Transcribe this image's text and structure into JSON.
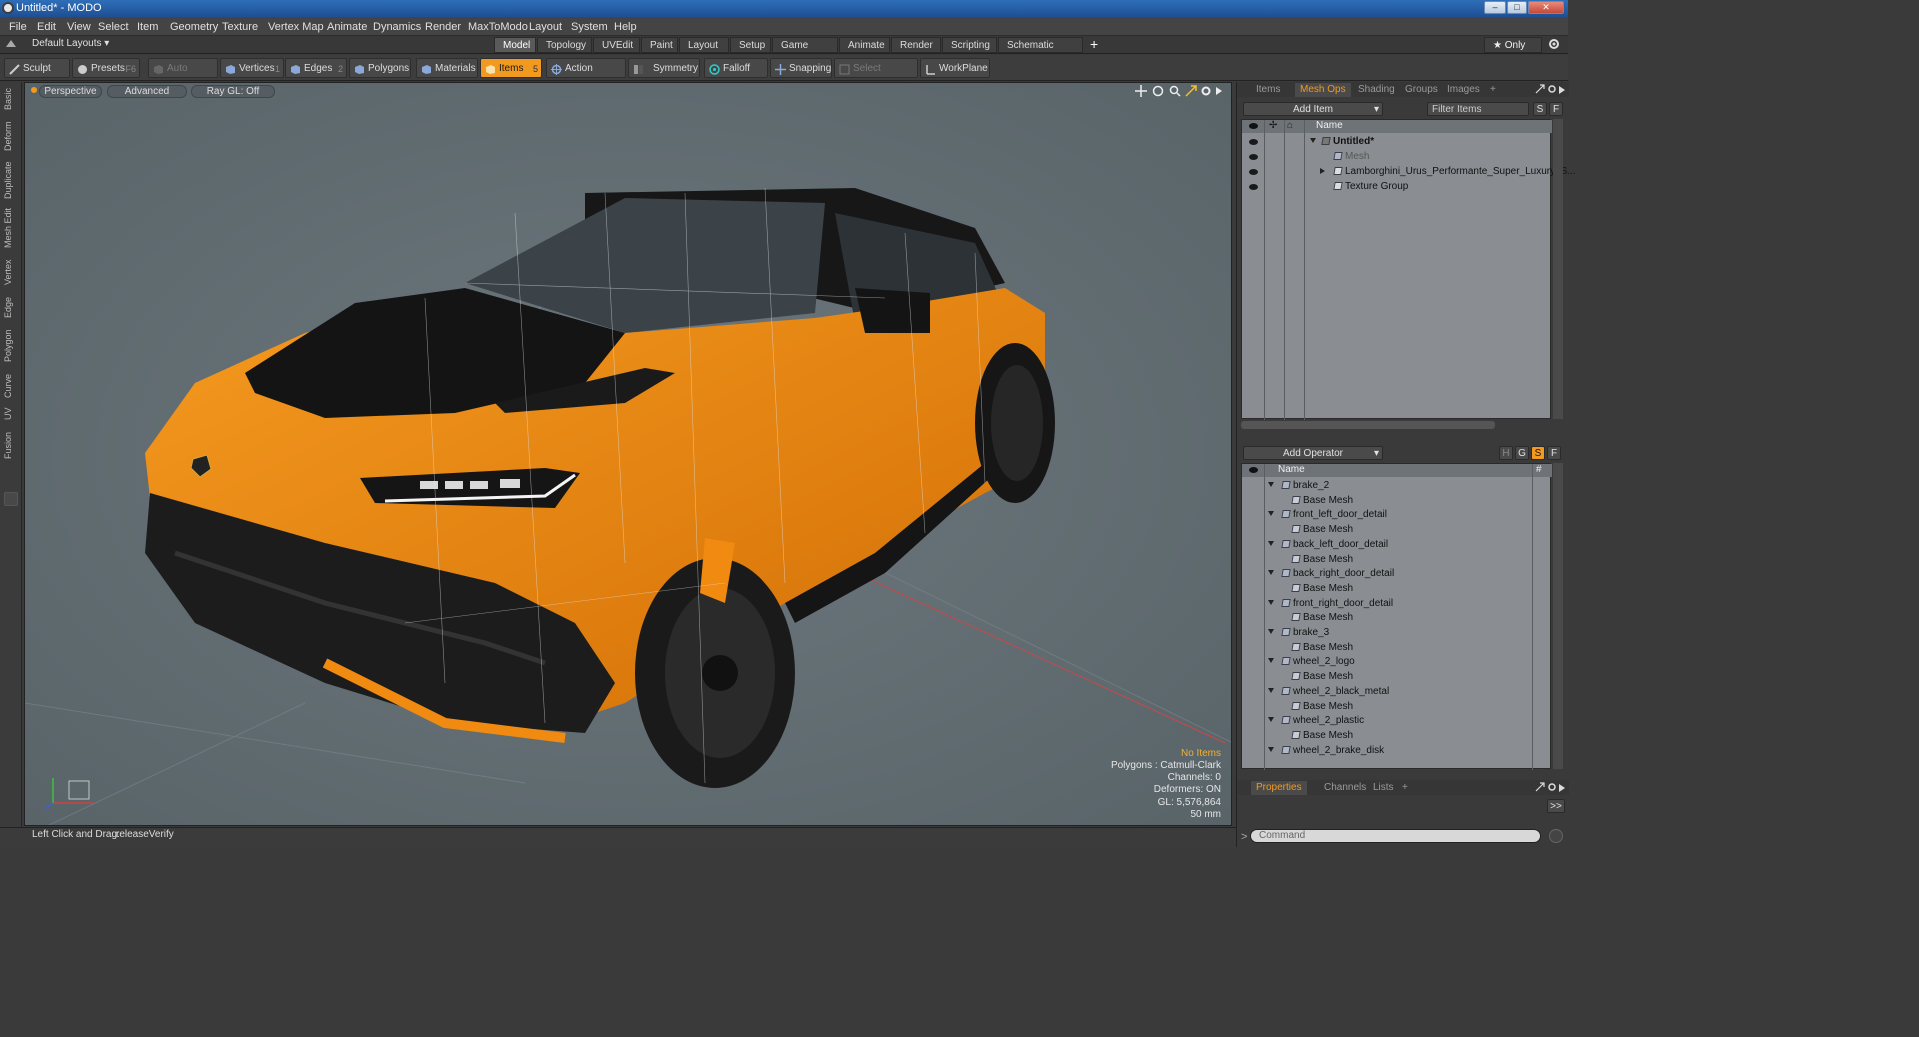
{
  "window": {
    "title": "Untitled* - MODO",
    "min": "–",
    "max": "□",
    "close": "✕"
  },
  "menubar": [
    "File",
    "Edit",
    "View",
    "Select",
    "Item",
    "Geometry",
    "Texture",
    "Vertex Map",
    "Animate",
    "Dynamics",
    "Render",
    "MaxToModo",
    "Layout",
    "System",
    "Help"
  ],
  "layoutbar": {
    "layouts_label": "Default Layouts ▾",
    "tabs": [
      "Model",
      "Topology",
      "UVEdit",
      "Paint",
      "Layout",
      "Setup",
      "Game Tools",
      "Animate",
      "Render",
      "Scripting",
      "Schematic Fusion"
    ],
    "active_tab": "Model",
    "add": "+",
    "only": "★  Only"
  },
  "toolbar": {
    "sculpt": "Sculpt",
    "presets": "Presets",
    "presets_key": "F6",
    "auto_select": "Auto Select",
    "vertices": "Vertices",
    "vertices_key": "1",
    "edges": "Edges",
    "edges_key": "2",
    "polygons": "Polygons",
    "materials": "Materials",
    "items": "Items",
    "items_key": "5",
    "action_center": "Action Center",
    "symmetry": "Symmetry",
    "falloff": "Falloff",
    "snapping": "Snapping",
    "select_through": "Select Through",
    "workplane": "WorkPlane"
  },
  "left_tabs": [
    "Basic",
    "Deform",
    "Duplicate",
    "Mesh Edit",
    "Vertex",
    "Edge",
    "Polygon",
    "Curve",
    "UV",
    "Fusion"
  ],
  "viewport": {
    "view_mode": "Perspective",
    "shading": "Advanced",
    "raygl": "Ray GL: Off",
    "info": {
      "items": "No Items",
      "polygons": "Polygons : Catmull-Clark",
      "channels": "Channels: 0",
      "deformers": "Deformers: ON",
      "gl": "GL: 5,576,864",
      "scale": "50 mm"
    }
  },
  "statusbar": {
    "hint_label": "Left Click and Drag:",
    "hint_value": "releaseVerify"
  },
  "items_panel": {
    "tabs": [
      "Items",
      "Mesh Ops",
      "Shading",
      "Groups",
      "Images"
    ],
    "active_tab": "Mesh Ops",
    "add_item": "Add Item",
    "filter": "Filter Items",
    "s_btn": "S",
    "f_btn": "F",
    "col_name": "Name",
    "tree": [
      {
        "label": "Untitled*",
        "level": 0
      },
      {
        "label": "Mesh",
        "level": 1
      },
      {
        "label": "Lamborghini_Urus_Performante_Super_Luxury_S...",
        "level": 1
      },
      {
        "label": "Texture Group",
        "level": 1
      }
    ]
  },
  "meshops_panel": {
    "add_operator": "Add Operator",
    "col_name": "Name",
    "col_hash": "#",
    "btn_h": "H",
    "btn_g": "G",
    "btn_s": "S",
    "btn_f": "F",
    "rows": [
      {
        "label": "brake_2",
        "child": "Base Mesh"
      },
      {
        "label": "front_left_door_detail",
        "child": "Base Mesh"
      },
      {
        "label": "back_left_door_detail",
        "child": "Base Mesh"
      },
      {
        "label": "back_right_door_detail",
        "child": "Base Mesh"
      },
      {
        "label": "front_right_door_detail",
        "child": "Base Mesh"
      },
      {
        "label": "brake_3",
        "child": "Base Mesh"
      },
      {
        "label": "wheel_2_logo",
        "child": "Base Mesh"
      },
      {
        "label": "wheel_2_black_metal",
        "child": "Base Mesh"
      },
      {
        "label": "wheel_2_plastic",
        "child": "Base Mesh"
      },
      {
        "label": "wheel_2_brake_disk",
        "child": ""
      }
    ]
  },
  "properties_panel": {
    "tabs": [
      "Properties",
      "Channels",
      "Lists"
    ],
    "active_tab": "Properties",
    "expand": ">>"
  },
  "command": {
    "placeholder": "Command"
  },
  "colors": {
    "accent": "#f29a1f",
    "viewport_bg": "#5f6b72",
    "car_orange": "#f08a10"
  }
}
